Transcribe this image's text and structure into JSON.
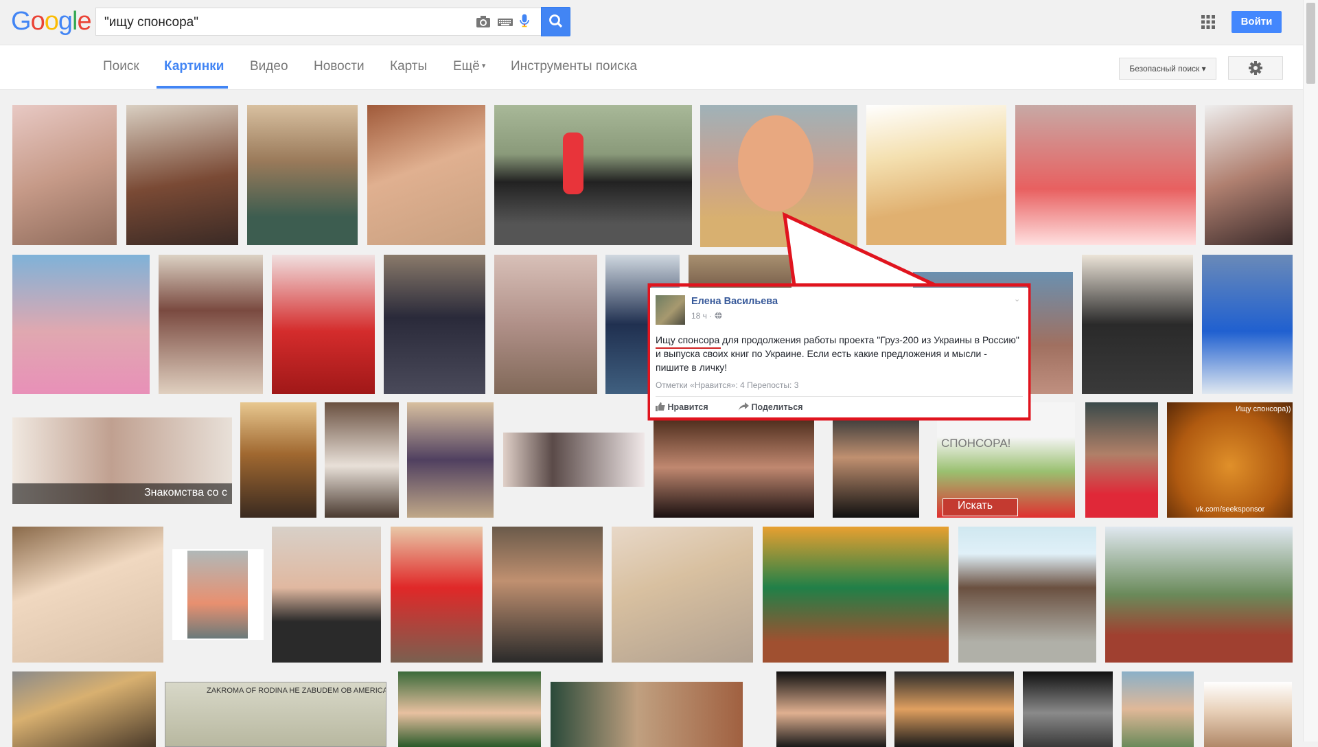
{
  "header": {
    "logo": {
      "letters": [
        "G",
        "o",
        "o",
        "g",
        "l",
        "e"
      ],
      "colors": [
        "#4285f4",
        "#ea4335",
        "#fbbc05",
        "#4285f4",
        "#34a853",
        "#ea4335"
      ]
    },
    "search_value": "\"ищу спонсора\"",
    "signin_label": "Войти"
  },
  "tabs": [
    {
      "label": "Поиск",
      "active": false
    },
    {
      "label": "Картинки",
      "active": true
    },
    {
      "label": "Видео",
      "active": false
    },
    {
      "label": "Новости",
      "active": false
    },
    {
      "label": "Карты",
      "active": false
    },
    {
      "label": "Ещё",
      "active": false
    },
    {
      "label": "Инструменты поиска",
      "active": false
    }
  ],
  "more_caret": "▾",
  "safe_search_label": "Безопасный поиск ▾",
  "image_overlay_texts": {
    "dating": "Знакомства со с",
    "sponsor_banner": "СПОНСОРА!",
    "search_button": "Искать",
    "cat_caption_top": "Ищу спонсора))",
    "cat_caption_bottom": "vk.com/seeksponsor",
    "dollar_text": "ZAKROMA OF RODINA  НЕ ZABUDEM OB AMERICA"
  },
  "facebook_post": {
    "author": "Елена Васильева",
    "time": "18 ч ·",
    "text": "Ищу спонсора для продолжения работы проекта \"Груз-200 из Украины в Россию\" и выпуска своих книг по Украине. Если есть какие предложения и мысли - пишите в личку!",
    "stats": "Отметки «Нравится»: 4   Перепосты: 3",
    "like_label": "Нравится",
    "share_label": "Поделиться"
  },
  "colors": {
    "accent": "#4285f4",
    "annotation": "#e0141e"
  }
}
